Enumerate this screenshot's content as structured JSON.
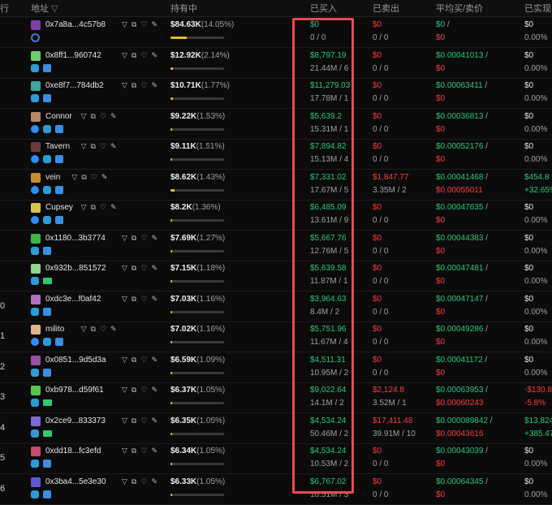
{
  "header": {
    "rank": "行",
    "address": "地址",
    "holding": "持有中",
    "bought": "已买入",
    "sold": "已卖出",
    "avg_price": "平均买/卖价",
    "realized": "已实现"
  },
  "rows": [
    {
      "rank": "",
      "addr": "0x7a8a...4c57b8",
      "color": "#7b3fa8",
      "hold": "$84.63K",
      "pct": "(14.05%)",
      "fill": 0.3,
      "buy": "$0",
      "buy_sub": "0 / 0",
      "sell": "$0",
      "sell_sub": "0 / 0",
      "avg_buy": "$0",
      "avg_sep": " /",
      "avg_sell": "$0",
      "real": "$0",
      "real_sub": "0.00%",
      "tags": [
        "ring"
      ]
    },
    {
      "rank": "",
      "addr": "0x8ff1...960742",
      "color": "#6bd06b",
      "hold": "$12.92K",
      "pct": "(2.14%)",
      "fill": 0.05,
      "buy": "$8,797.19",
      "buy_sub": "21.44M / 6",
      "sell": "$0",
      "sell_sub": "0 / 0",
      "avg_buy": "$0.00041013",
      "avg_sep": " /",
      "avg_sell": "$0",
      "real": "$0",
      "real_sub": "0.00%",
      "tags": [
        "user",
        "bot"
      ]
    },
    {
      "rank": "",
      "addr": "0xe8f7...784db2",
      "color": "#3da59a",
      "hold": "$10.71K",
      "pct": "(1.77%)",
      "fill": 0.04,
      "buy": "$11,279.03",
      "buy_sub": "17.78M / 1",
      "sell": "$0",
      "sell_sub": "0 / 0",
      "avg_buy": "$0.00063411",
      "avg_sep": " /",
      "avg_sell": "$0",
      "real": "$0",
      "real_sub": "0.00%",
      "tags": [
        "user",
        "bot"
      ]
    },
    {
      "rank": "",
      "addr": "Connor",
      "color": "#b7876a",
      "hold": "$9.22K",
      "pct": "(1.53%)",
      "fill": 0.03,
      "buy": "$5,639.2",
      "buy_sub": "15.31M / 1",
      "sell": "$0",
      "sell_sub": "0 / 0",
      "avg_buy": "$0.00036813",
      "avg_sep": " /",
      "avg_sell": "$0",
      "real": "$0",
      "real_sub": "0.00%",
      "tags": [
        "verify",
        "user",
        "bot"
      ]
    },
    {
      "rank": "",
      "addr": "Tavern",
      "color": "#6b3a3a",
      "hold": "$9.11K",
      "pct": "(1.51%)",
      "fill": 0.03,
      "buy": "$7,894.82",
      "buy_sub": "15.13M / 4",
      "sell": "$0",
      "sell_sub": "0 / 0",
      "avg_buy": "$0.00052176",
      "avg_sep": " /",
      "avg_sell": "$0",
      "real": "$0",
      "real_sub": "0.00%",
      "tags": [
        "verify",
        "user",
        "bot"
      ]
    },
    {
      "rank": "",
      "addr": "vein",
      "color": "#c98a2e",
      "hold": "$8.62K",
      "pct": "(1.43%)",
      "fill": 0.07,
      "buy": "$7,331.02",
      "buy_sub": "17.67M / 5",
      "sell": "$1,847.77",
      "sell_sub": "3.35M / 2",
      "avg_buy": "$0.00041468",
      "avg_sep": " /",
      "avg_sell": "$0.00055011",
      "real": "$454.8",
      "real_sub": "+32.65%",
      "tags": [
        "verify",
        "user",
        "bot"
      ]
    },
    {
      "rank": "",
      "addr": "Cupsey",
      "color": "#d9c24a",
      "hold": "$8.2K",
      "pct": "(1.36%)",
      "fill": 0.03,
      "buy": "$6,485.09",
      "buy_sub": "13.61M / 9",
      "sell": "$0",
      "sell_sub": "0 / 0",
      "avg_buy": "$0.00047635",
      "avg_sep": " /",
      "avg_sell": "$0",
      "real": "$0",
      "real_sub": "0.00%",
      "tags": [
        "verify",
        "user",
        "bot"
      ]
    },
    {
      "rank": "",
      "addr": "0x1180...3b3774",
      "color": "#3fb54a",
      "hold": "$7.69K",
      "pct": "(1.27%)",
      "fill": 0.03,
      "buy": "$5,667.76",
      "buy_sub": "12.76M / 5",
      "sell": "$0",
      "sell_sub": "0 / 0",
      "avg_buy": "$0.00044383",
      "avg_sep": " /",
      "avg_sell": "$0",
      "real": "$0",
      "real_sub": "0.00%",
      "tags": [
        "user",
        "bot"
      ]
    },
    {
      "rank": "",
      "addr": "0x932b...851572",
      "color": "#8fd48f",
      "hold": "$7.15K",
      "pct": "(1.18%)",
      "fill": 0.03,
      "buy": "$5,639.58",
      "buy_sub": "11.87M / 1",
      "sell": "$0",
      "sell_sub": "0 / 0",
      "avg_buy": "$0.00047481",
      "avg_sep": " /",
      "avg_sell": "$0",
      "real": "$0",
      "real_sub": "0.00%",
      "tags": [
        "user",
        "card"
      ]
    },
    {
      "rank": "0",
      "addr": "0xdc3e...f0af42",
      "color": "#b06fc4",
      "hold": "$7.03K",
      "pct": "(1.16%)",
      "fill": 0.03,
      "buy": "$3,964.63",
      "buy_sub": "8.4M / 2",
      "sell": "$0",
      "sell_sub": "0 / 0",
      "avg_buy": "$0.00047147",
      "avg_sep": " /",
      "avg_sell": "$0",
      "real": "$0",
      "real_sub": "0.00%",
      "tags": [
        "user",
        "bot"
      ]
    },
    {
      "rank": "1",
      "addr": "milito",
      "color": "#e0b48a",
      "hold": "$7.02K",
      "pct": "(1.16%)",
      "fill": 0.03,
      "buy": "$5,751.96",
      "buy_sub": "11.67M / 4",
      "sell": "$0",
      "sell_sub": "0 / 0",
      "avg_buy": "$0.00049286",
      "avg_sep": " /",
      "avg_sell": "$0",
      "real": "$0",
      "real_sub": "0.00%",
      "tags": [
        "verify",
        "user",
        "bot"
      ]
    },
    {
      "rank": "2",
      "addr": "0x0851...9d5d3a",
      "color": "#9a4fa0",
      "hold": "$6.59K",
      "pct": "(1.09%)",
      "fill": 0.03,
      "buy": "$4,511.31",
      "buy_sub": "10.95M / 2",
      "sell": "$0",
      "sell_sub": "0 / 0",
      "avg_buy": "$0.00041172",
      "avg_sep": " /",
      "avg_sell": "$0",
      "real": "$0",
      "real_sub": "0.00%",
      "tags": [
        "user",
        "bot"
      ]
    },
    {
      "rank": "3",
      "addr": "0xb978...d59f61",
      "color": "#5bc44a",
      "hold": "$6.37K",
      "pct": "(1.05%)",
      "fill": 0.03,
      "buy": "$9,022.64",
      "buy_sub": "14.1M / 2",
      "sell": "$2,124.8",
      "sell_sub": "3.52M / 1",
      "avg_buy": "$0.00063953",
      "avg_sep": " /",
      "avg_sell": "$0.00060243",
      "real": "-$130.8",
      "real_sub": "-5.8%",
      "tags": [
        "user",
        "card"
      ]
    },
    {
      "rank": "4",
      "addr": "0x2ce9...833373",
      "color": "#7a6ad4",
      "hold": "$6.35K",
      "pct": "(1.05%)",
      "fill": 0.03,
      "buy": "$4,534.24",
      "buy_sub": "50.46M / 2",
      "sell": "$17,411.48",
      "sell_sub": "39.91M / 10",
      "avg_buy": "$0.000089842",
      "avg_sep": " /",
      "avg_sell": "$0.00043616",
      "real": "$13,824",
      "real_sub": "+385.47",
      "tags": [
        "user",
        "card"
      ]
    },
    {
      "rank": "5",
      "addr": "0xdd18...fc3efd",
      "color": "#c44a6a",
      "hold": "$6.34K",
      "pct": "(1.05%)",
      "fill": 0.03,
      "buy": "$4,534.24",
      "buy_sub": "10.53M / 2",
      "sell": "$0",
      "sell_sub": "0 / 0",
      "avg_buy": "$0.00043039",
      "avg_sep": " /",
      "avg_sell": "$0",
      "real": "$0",
      "real_sub": "0.00%",
      "tags": [
        "user",
        "bot"
      ]
    },
    {
      "rank": "6",
      "addr": "0x3ba4...5e3e30",
      "color": "#5a5ad4",
      "hold": "$6.33K",
      "pct": "(1.05%)",
      "fill": 0.03,
      "buy": "$6,767.02",
      "buy_sub": "10.51M / 3",
      "sell": "$0",
      "sell_sub": "0 / 0",
      "avg_buy": "$0.00064345",
      "avg_sep": " /",
      "avg_sell": "$0",
      "real": "$0",
      "real_sub": "0.00%",
      "tags": [
        "user",
        "bot"
      ]
    }
  ],
  "icon_names": [
    "filter-icon",
    "copy-icon",
    "heart-icon",
    "edit-icon"
  ]
}
